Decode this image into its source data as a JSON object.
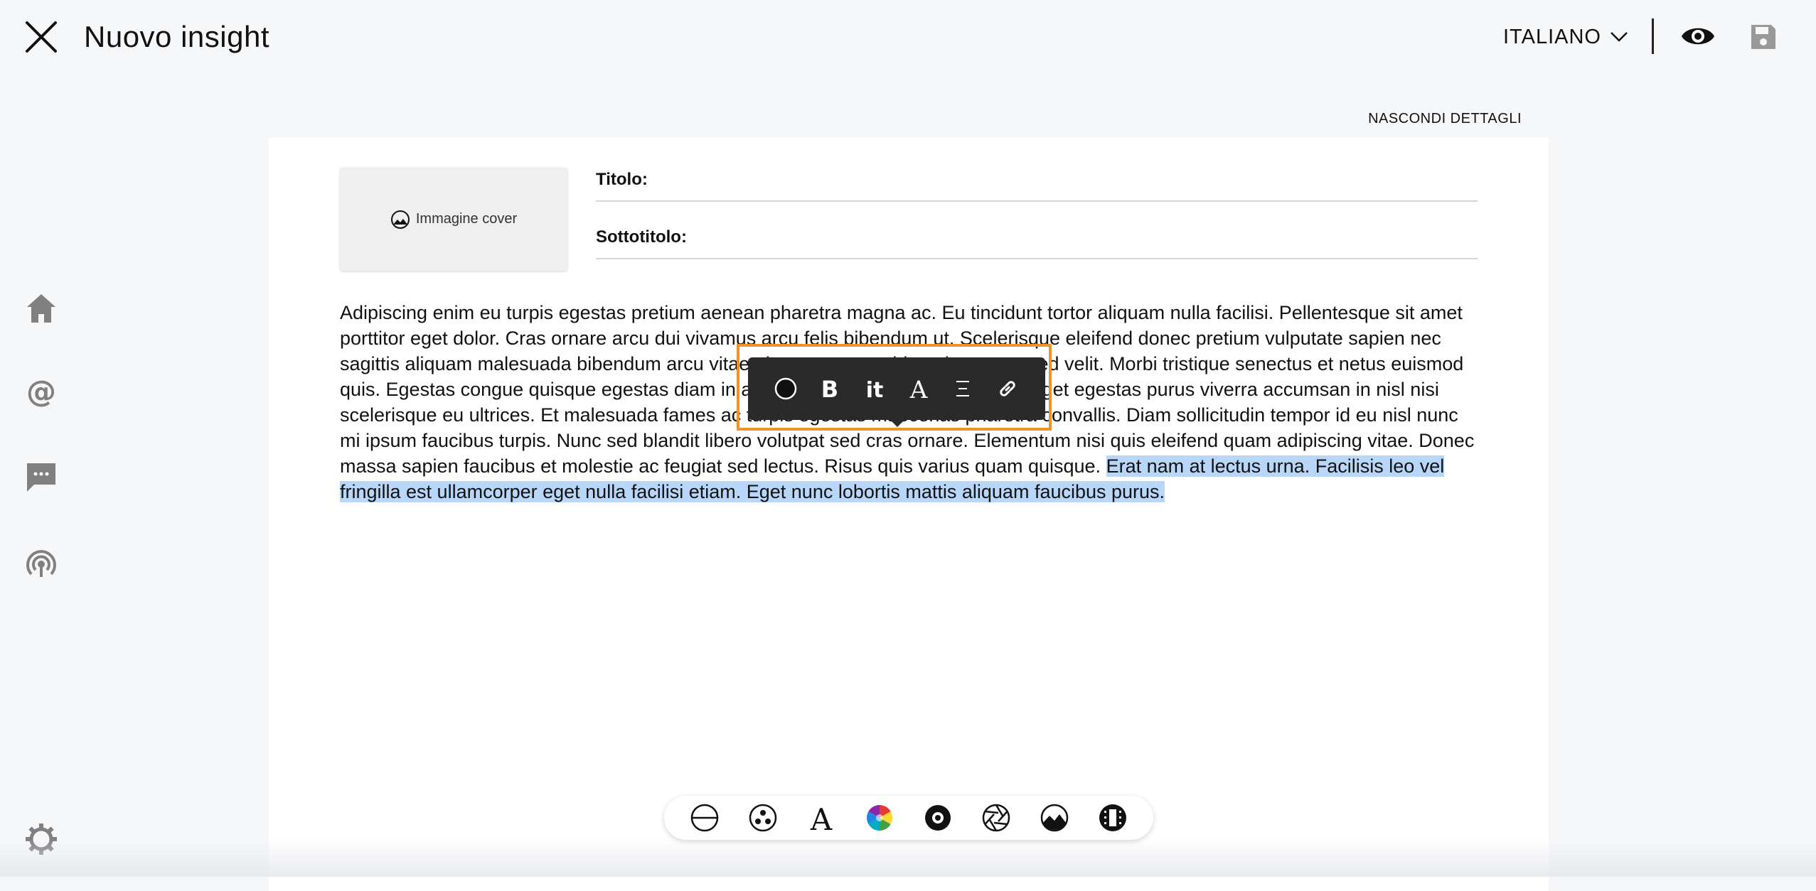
{
  "header": {
    "title": "Nuovo insight",
    "language": "ITALIANO"
  },
  "details_toggle": "NASCONDI DETTAGLI",
  "editor": {
    "cover_label": "Immagine cover",
    "title_label": "Titolo:",
    "title_value": "",
    "subtitle_label": "Sottotitolo:",
    "subtitle_value": "",
    "body_plain": "Adipiscing enim eu turpis egestas pretium aenean pharetra magna ac. Eu tincidunt tortor aliquam nulla facilisi. Pellentesque sit amet porttitor eget dolor. Cras ornare arcu dui vivamus arcu felis bibendum ut. Scelerisque eleifend donec pretium vulputate sapien nec sagittis aliquam malesuada bibendum arcu vitae elementum curabitur vitae nunc sed velit. Morbi tristique senectus et netus euismod quis. Egestas congue quisque egestas diam in arcu. Blandit turpis cursus in hac. Eget egestas purus viverra accumsan in nisl nisi scelerisque eu ultrices. Et malesuada fames ac turpis egestas maecenas pharetra convallis. Diam sollicitudin tempor id eu nisl nunc mi ipsum faucibus turpis. Nunc sed blandit libero volutpat sed cras ornare. Elementum nisi quis eleifend quam adipiscing vitae. Donec massa sapien faucibus et molestie ac feugiat sed lectus. Risus quis varius quam quisque. ",
    "body_selected": "Erat nam at lectus urna. Facilisis leo vel fringilla est ullamcorper eget nulla facilisi etiam. Eget nunc lobortis mattis aliquam faucibus purus."
  },
  "format_toolbar": [
    "circle-icon",
    "bold-icon",
    "italic-icon",
    "font-icon",
    "align-icon",
    "link-icon"
  ],
  "insert_toolbar": [
    "divider-icon",
    "bubble-icon",
    "font-icon",
    "color-wheel-icon",
    "circle-target-icon",
    "aperture-icon",
    "image-icon",
    "film-icon"
  ],
  "colors": {
    "accent_outline": "#f0912a",
    "selection": "#b8d6f7",
    "toolbar_bg": "#2a2a2a"
  }
}
